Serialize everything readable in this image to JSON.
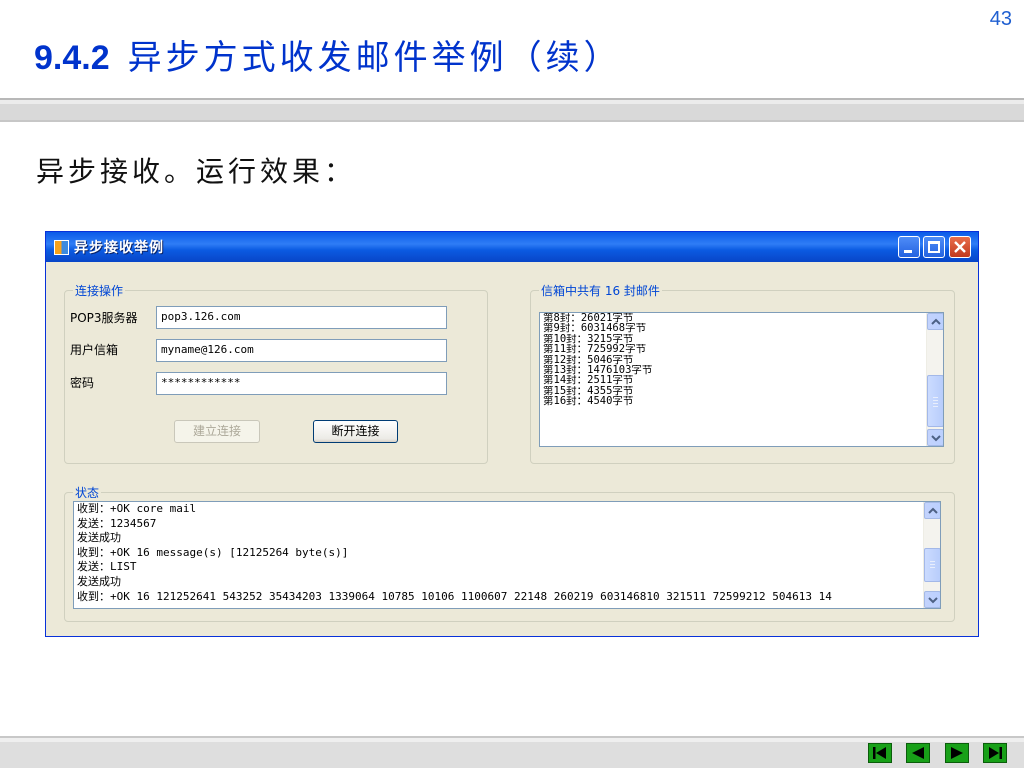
{
  "slide": {
    "number": "43",
    "title_number": "9.4.2",
    "title_text": "异步方式收发邮件举例（续）",
    "subtitle": "异步接收。运行效果："
  },
  "window": {
    "title": "异步接收举例",
    "titlebar_color": "#0a5ae8",
    "controls": [
      "minimize-icon",
      "maximize-icon",
      "close-icon"
    ]
  },
  "connection": {
    "legend": "连接操作",
    "server_label": "POP3服务器",
    "server_value": "pop3.126.com",
    "user_label": "用户信箱",
    "user_value": "myname@126.com",
    "password_label": "密码",
    "password_value": "************",
    "connect_button": "建立连接",
    "disconnect_button": "断开连接"
  },
  "mailbox": {
    "legend": "信箱中共有  16  封邮件",
    "items": [
      "第8封：26021字节",
      "第9封：6031468字节",
      "第10封：3215字节",
      "第11封：725992字节",
      "第12封：5046字节",
      "第13封：1476103字节",
      "第14封：2511字节",
      "第15封：4355字节",
      "第16封：4540字节"
    ]
  },
  "status": {
    "legend": "状态",
    "lines": [
      "收到：+OK core mail",
      "发送：1234567",
      "发送成功",
      "收到：+OK 16 message(s) [12125264 byte(s)]",
      "发送：LIST",
      "发送成功",
      "收到：+OK 16 121252641 543252 35434203 1339064 10785 10106 1100607 22148 260219 603146810 321511 72599212 504613 14"
    ]
  },
  "navigation": {
    "icons": [
      "first-page-icon",
      "previous-page-icon",
      "next-page-icon",
      "last-page-icon"
    ],
    "color": "#18a018"
  }
}
